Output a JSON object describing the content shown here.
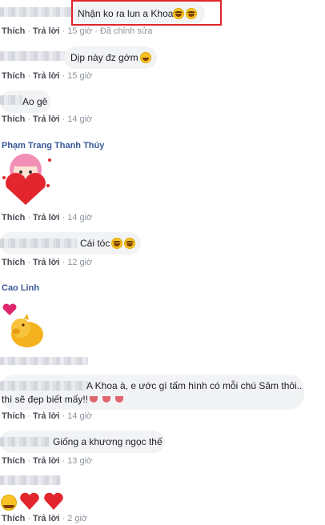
{
  "comments": [
    {
      "text": "Nhận ko ra lun a Khoa",
      "time": "15 giờ",
      "edited": "Đã chỉnh sửa"
    },
    {
      "text": "Dịp này đz gớm",
      "time": "15 giờ"
    },
    {
      "text": "Ao gê",
      "time": "14 giờ"
    },
    {
      "author": "Phạm Trang Thanh Thúy",
      "time": "14 giờ"
    },
    {
      "text": "Cái tóc",
      "time": "12 giờ"
    },
    {
      "author": "Cao Linh"
    },
    {
      "text_line1": "A Khoa à, e ước gì tấm hình có mỗi chú Sâm thôi..",
      "text_line2": "thì sẽ đẹp biết mấy!!",
      "time": "14 giờ"
    },
    {
      "text": "Giống a khương ngọc thế",
      "time": "13 giờ"
    },
    {
      "time": "2 giờ"
    }
  ],
  "labels": {
    "like": "Thích",
    "reply": "Trả lời",
    "dot": "·"
  },
  "colors": {
    "author": "#385898",
    "bubble": "#f2f3f5",
    "highlight": "#e0252b"
  }
}
